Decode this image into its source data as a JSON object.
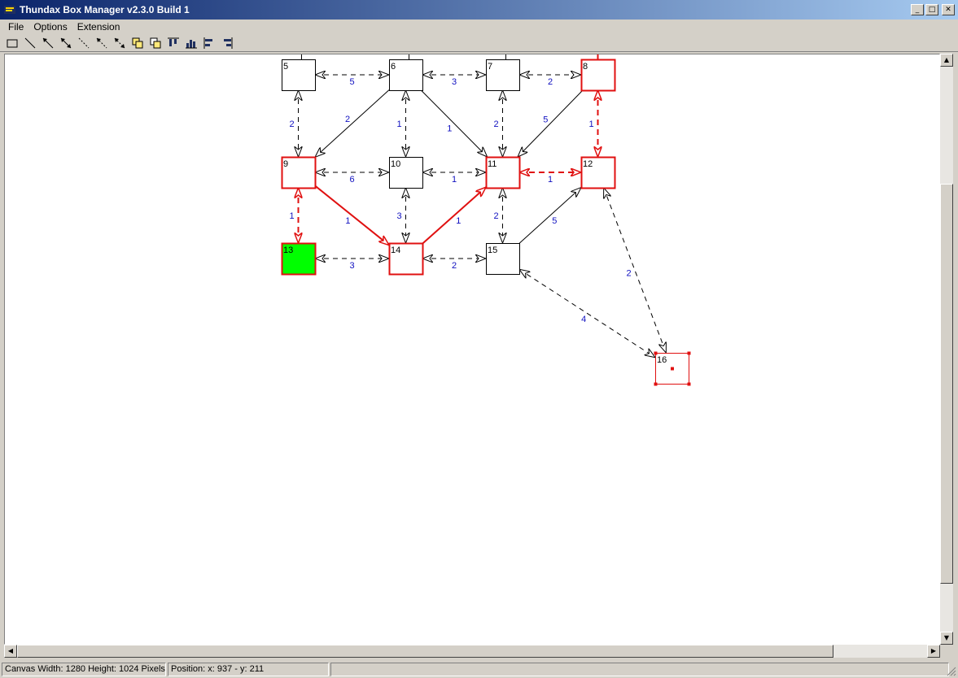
{
  "window": {
    "title": "Thundax Box Manager v2.3.0 Build 1",
    "buttons": [
      "_",
      "□",
      "✕"
    ]
  },
  "menu": {
    "items": [
      "File",
      "Options",
      "Extension"
    ]
  },
  "toolbar": {
    "tools": [
      "box-tool",
      "line-tool",
      "arrow-tool",
      "double-arrow-tool",
      "dashed-line-tool",
      "dashed-arrow-tool",
      "dashed-double-arrow-tool",
      "copy-tool",
      "paste-tool",
      "align-top-tool",
      "chart-tool",
      "align-left-tool",
      "align-right-tool"
    ]
  },
  "graph": {
    "colors": {
      "highlight": "#e01010",
      "start_fill": "#00ff00",
      "edge_weight": "#1010c0",
      "edge": "#000000"
    },
    "nodes": [
      {
        "id": "5",
        "state": "normal"
      },
      {
        "id": "6",
        "state": "normal"
      },
      {
        "id": "7",
        "state": "normal"
      },
      {
        "id": "8",
        "state": "highlighted"
      },
      {
        "id": "9",
        "state": "highlighted"
      },
      {
        "id": "10",
        "state": "normal"
      },
      {
        "id": "11",
        "state": "highlighted"
      },
      {
        "id": "12",
        "state": "highlighted"
      },
      {
        "id": "13",
        "state": "start"
      },
      {
        "id": "14",
        "state": "highlighted"
      },
      {
        "id": "15",
        "state": "normal"
      },
      {
        "id": "16",
        "state": "selected"
      }
    ],
    "edges": [
      {
        "from": "5",
        "to": "6",
        "weight": "5",
        "style": "dashed",
        "direction": "both",
        "path": false
      },
      {
        "from": "6",
        "to": "7",
        "weight": "3",
        "style": "dashed",
        "direction": "both",
        "path": false
      },
      {
        "from": "7",
        "to": "8",
        "weight": "2",
        "style": "dashed",
        "direction": "both",
        "path": false
      },
      {
        "from": "5",
        "to": "9",
        "weight": "2",
        "style": "dashed",
        "direction": "both",
        "path": false
      },
      {
        "from": "6",
        "to": "9",
        "weight": "2",
        "style": "solid",
        "direction": "forward",
        "path": false
      },
      {
        "from": "6",
        "to": "10",
        "weight": "1",
        "style": "dashed",
        "direction": "both",
        "path": false
      },
      {
        "from": "6",
        "to": "11",
        "weight": "1",
        "style": "solid",
        "direction": "forward",
        "path": false
      },
      {
        "from": "7",
        "to": "11",
        "weight": "2",
        "style": "dashed",
        "direction": "both",
        "path": false
      },
      {
        "from": "8",
        "to": "11",
        "weight": "5",
        "style": "solid",
        "direction": "forward",
        "path": false
      },
      {
        "from": "8",
        "to": "12",
        "weight": "1",
        "style": "dashed",
        "direction": "both",
        "path": true
      },
      {
        "from": "9",
        "to": "10",
        "weight": "6",
        "style": "dashed",
        "direction": "both",
        "path": false
      },
      {
        "from": "10",
        "to": "11",
        "weight": "1",
        "style": "dashed",
        "direction": "both",
        "path": false
      },
      {
        "from": "11",
        "to": "12",
        "weight": "1",
        "style": "dashed",
        "direction": "both",
        "path": true
      },
      {
        "from": "9",
        "to": "13",
        "weight": "1",
        "style": "dashed",
        "direction": "both",
        "path": true
      },
      {
        "from": "9",
        "to": "14",
        "weight": "1",
        "style": "solid",
        "direction": "forward",
        "path": true
      },
      {
        "from": "10",
        "to": "14",
        "weight": "3",
        "style": "dashed",
        "direction": "both",
        "path": false
      },
      {
        "from": "14",
        "to": "11",
        "weight": "1",
        "style": "solid",
        "direction": "forward",
        "path": true
      },
      {
        "from": "11",
        "to": "15",
        "weight": "2",
        "style": "dashed",
        "direction": "both",
        "path": false
      },
      {
        "from": "15",
        "to": "12",
        "weight": "5",
        "style": "solid",
        "direction": "forward",
        "path": false
      },
      {
        "from": "13",
        "to": "14",
        "weight": "3",
        "style": "dashed",
        "direction": "both",
        "path": false
      },
      {
        "from": "14",
        "to": "15",
        "weight": "2",
        "style": "dashed",
        "direction": "both",
        "path": false
      },
      {
        "from": "12",
        "to": "16",
        "weight": "2",
        "style": "dashed",
        "direction": "both",
        "path": false
      },
      {
        "from": "15",
        "to": "16",
        "weight": "4",
        "style": "dashed",
        "direction": "both",
        "path": false
      }
    ]
  },
  "status": {
    "canvas": "Canvas Width: 1280 Height: 1024 Pixels",
    "position": "Position: x: 937 - y: 211",
    "extra": ""
  }
}
